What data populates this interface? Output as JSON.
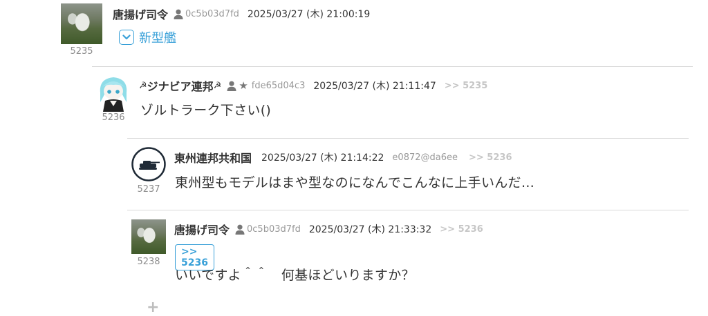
{
  "posts": [
    {
      "number": "5235",
      "name": "唐揚げ司令",
      "user_id": "0c5b03d7fd",
      "datetime": "2025/03/27 (木) 21:00:19",
      "expand_label": "新型艦"
    },
    {
      "number": "5236",
      "name_prefix": "☭",
      "name": "ジナビア連邦",
      "name_suffix": "☭",
      "star": "★",
      "user_id": "fde65d04c3",
      "datetime": "2025/03/27 (木) 21:11:47",
      "reply_ref": ">> 5235",
      "body": "ゾルトラーク下さい()"
    },
    {
      "number": "5237",
      "name": "東州連邦共和国",
      "datetime": "2025/03/27 (木) 21:14:22",
      "user_id": "e0872@da6ee",
      "reply_ref": ">> 5236",
      "body": "東州型もモデルはまや型なのになんでこんなに上手いんだ…"
    },
    {
      "number": "5238",
      "name": "唐揚げ司令",
      "user_id": "0c5b03d7fd",
      "datetime": "2025/03/27 (木) 21:33:32",
      "reply_ref": ">> 5236",
      "quote_chip": ">> 5236",
      "body": "いいですよ＾＾　何基ほどいりますか？"
    }
  ],
  "add_symbol": "+",
  "colors": {
    "link_blue": "#38a0d8",
    "muted": "#999999",
    "divider": "#d9d9d9"
  }
}
